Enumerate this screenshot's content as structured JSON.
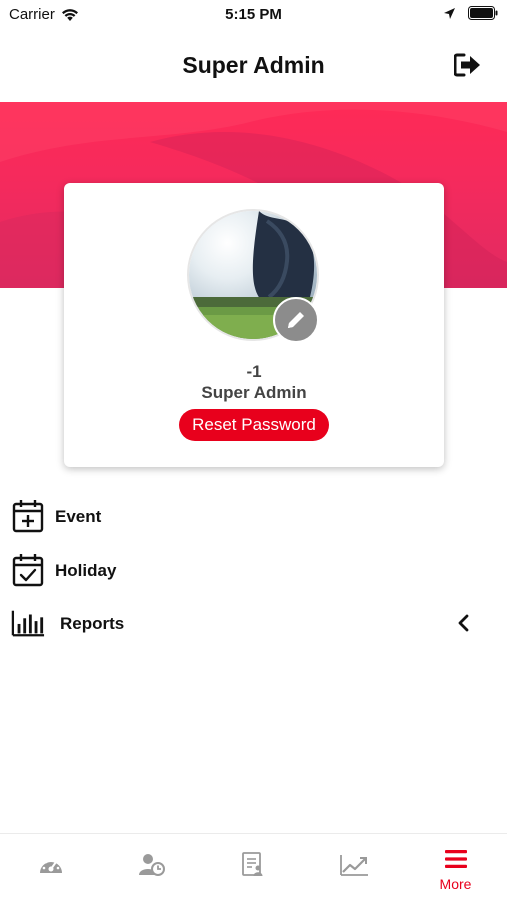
{
  "status_bar": {
    "carrier": "Carrier",
    "time": "5:15 PM"
  },
  "header": {
    "title": "Super Admin",
    "logout_icon": "logout-icon"
  },
  "profile": {
    "id": "-1",
    "name": "Super Admin",
    "reset_password_label": "Reset Password",
    "edit_icon": "pencil-icon"
  },
  "menu": {
    "items": [
      {
        "label": "Event",
        "icon": "calendar-plus-icon"
      },
      {
        "label": "Holiday",
        "icon": "calendar-check-icon"
      },
      {
        "label": "Reports",
        "icon": "bar-chart-icon",
        "expand_icon": "chevron-left-icon"
      }
    ]
  },
  "tab_bar": {
    "tabs": [
      {
        "icon": "dashboard-gauge-icon",
        "label": ""
      },
      {
        "icon": "user-clock-icon",
        "label": ""
      },
      {
        "icon": "document-user-icon",
        "label": ""
      },
      {
        "icon": "trend-chart-icon",
        "label": ""
      },
      {
        "icon": "menu-icon",
        "label": "More",
        "active": true
      }
    ]
  },
  "colors": {
    "accent": "#e8001c",
    "banner_top": "#ff2a56",
    "banner_bottom": "#e02a62",
    "inactive_icon": "#9a9a9a"
  }
}
